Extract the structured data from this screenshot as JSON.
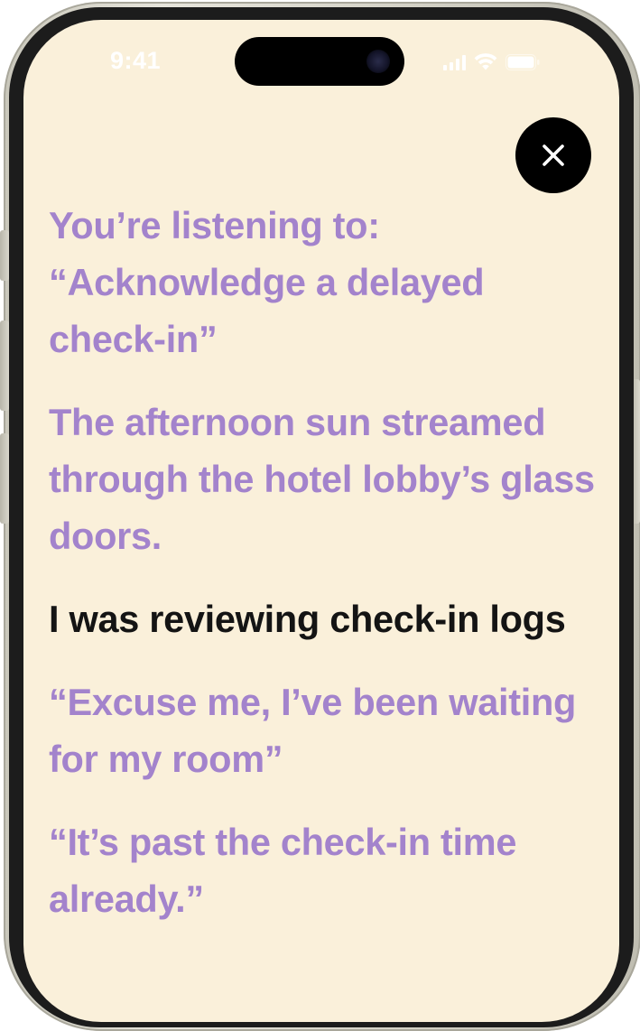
{
  "status_bar": {
    "time": "9:41",
    "icons": [
      "cellular-signal-icon",
      "wifi-icon",
      "battery-icon"
    ]
  },
  "close_button": {
    "icon": "close-icon",
    "glyph": "×"
  },
  "transcript": {
    "header_line1": "You’re listening to:",
    "header_line2": "“Acknowledge a delayed check-in”",
    "lines": [
      {
        "text": "The afternoon sun streamed through the hotel lobby’s glass doors.",
        "state": "faded"
      },
      {
        "text": "I was reviewing check-in logs",
        "state": "active"
      },
      {
        "text": "“Excuse me, I’ve been waiting for my room”",
        "state": "faded"
      },
      {
        "text": "“It’s past the check-in time already.”",
        "state": "faded"
      }
    ]
  },
  "colors": {
    "background": "#faf0da",
    "faded_text": "#a383cc",
    "active_text": "#141414",
    "close_button_bg": "#000000"
  }
}
